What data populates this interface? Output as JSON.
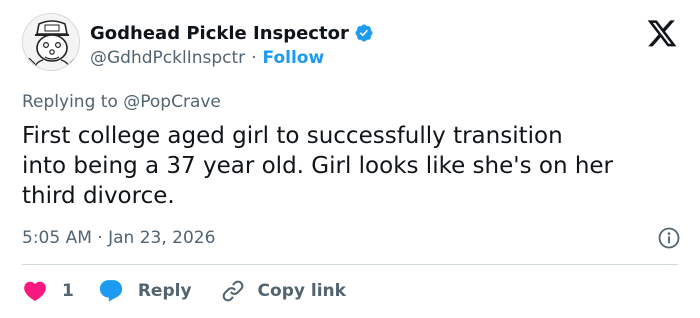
{
  "author": {
    "display_name": "Godhead Pickle Inspector",
    "handle": "@GdhdPcklInspctr",
    "separator": "·",
    "follow_label": "Follow",
    "verified": true
  },
  "reply_context": {
    "prefix": "Replying to ",
    "mention": "@PopCrave"
  },
  "tweet": {
    "text": "First college aged girl to successfully transition\ninto being a 37 year old. Girl looks like she's on her\nthird divorce.",
    "time": "5:05 AM",
    "date_separator": " · ",
    "date": "Jan 23, 2026"
  },
  "actions": {
    "like_count": "1",
    "reply_label": "Reply",
    "copy_label": "Copy link"
  },
  "icons": {
    "verified": "verified-badge-icon",
    "brand": "x-logo-icon",
    "info": "info-icon",
    "like": "heart-icon",
    "reply": "speech-bubble-icon",
    "copy": "link-icon"
  },
  "colors": {
    "accent": "#1d9bf0",
    "like": "#f91880",
    "text": "#0f1419",
    "secondary": "#536471",
    "divider": "#cfd9de"
  }
}
